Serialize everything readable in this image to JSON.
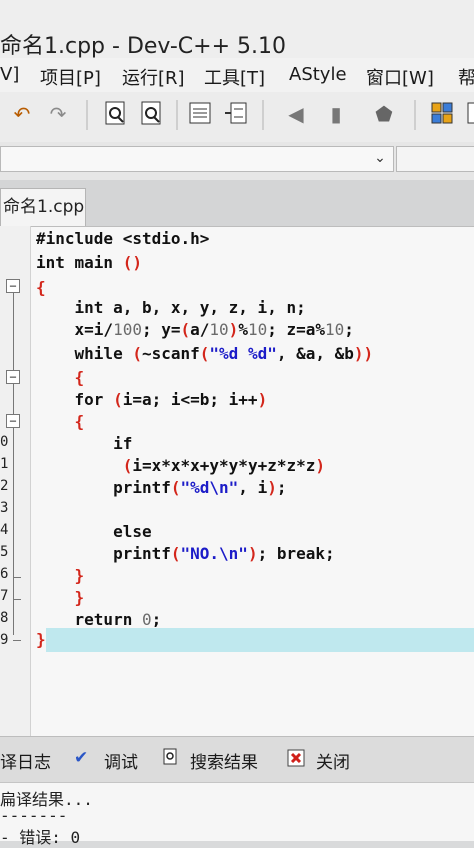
{
  "window": {
    "title": "命名1.cpp - Dev-C++ 5.10"
  },
  "menu": [
    "V]",
    "项目[P]",
    "运行[R]",
    "工具[T]",
    "AStyle",
    "窗口[W]",
    "帮"
  ],
  "tab": {
    "file": "命名1.cpp"
  },
  "gutter": {
    "line_numbers": [
      "0",
      "1",
      "2",
      "3",
      "4",
      "5",
      "6",
      "7",
      "8",
      "9"
    ]
  },
  "code": [
    [
      [
        "#include <stdio.h>",
        ""
      ]
    ],
    [
      [
        "int main ",
        ""
      ],
      [
        "()",
        "p"
      ]
    ],
    [
      [
        "{",
        "p"
      ]
    ],
    [
      [
        "    int a, b, x, y, z, i, n;",
        ""
      ]
    ],
    [
      [
        "    x=i/",
        ""
      ],
      [
        "100",
        "n"
      ],
      [
        "; y=",
        ""
      ],
      [
        "(",
        "p"
      ],
      [
        "a/",
        ""
      ],
      [
        "10",
        "n"
      ],
      [
        ")",
        "p"
      ],
      [
        "%",
        ""
      ],
      [
        "10",
        "n"
      ],
      [
        "; z=a%",
        ""
      ],
      [
        "10",
        "n"
      ],
      [
        ";",
        ""
      ]
    ],
    [
      [
        "    while ",
        ""
      ],
      [
        "(",
        "p"
      ],
      [
        "~scanf",
        ""
      ],
      [
        "(",
        "p"
      ],
      [
        "\"%d %d\"",
        "s"
      ],
      [
        ", &a, &b",
        ""
      ],
      [
        "))",
        "p"
      ]
    ],
    [
      [
        "    {",
        "p"
      ]
    ],
    [
      [
        "    for ",
        ""
      ],
      [
        "(",
        "p"
      ],
      [
        "i=a; i<=b; i++",
        ""
      ],
      [
        ")",
        "p"
      ]
    ],
    [
      [
        "    {",
        "p"
      ]
    ],
    [
      [
        "        if",
        ""
      ]
    ],
    [
      [
        "         ",
        ""
      ],
      [
        "(",
        "p"
      ],
      [
        "i=x*x*x+y*y*y+z*z*z",
        ""
      ],
      [
        ")",
        "p"
      ]
    ],
    [
      [
        "        printf",
        ""
      ],
      [
        "(",
        "p"
      ],
      [
        "\"%d\\n\"",
        "s"
      ],
      [
        ", i",
        ""
      ],
      [
        ")",
        "p"
      ],
      [
        ";",
        ""
      ]
    ],
    [
      [
        "",
        ""
      ]
    ],
    [
      [
        "        else",
        ""
      ]
    ],
    [
      [
        "        printf",
        ""
      ],
      [
        "(",
        "p"
      ],
      [
        "\"NO.\\n\"",
        "s"
      ],
      [
        ")",
        "p"
      ],
      [
        "; break;",
        ""
      ]
    ],
    [
      [
        "    }",
        "p"
      ]
    ],
    [
      [
        "    }",
        "p"
      ]
    ],
    [
      [
        "    return ",
        ""
      ],
      [
        "0",
        "n"
      ],
      [
        ";",
        ""
      ]
    ],
    [
      [
        "}",
        "p"
      ]
    ]
  ],
  "bottom_tabs": [
    "译日志",
    "调试",
    "搜索结果",
    "关闭"
  ],
  "output": {
    "line1": "扁译结果...",
    "line2": "-------",
    "line3": "- 错误: 0"
  },
  "icons": {
    "debug": "check-mark-icon",
    "search": "search-results-icon",
    "close": "close-icon"
  }
}
